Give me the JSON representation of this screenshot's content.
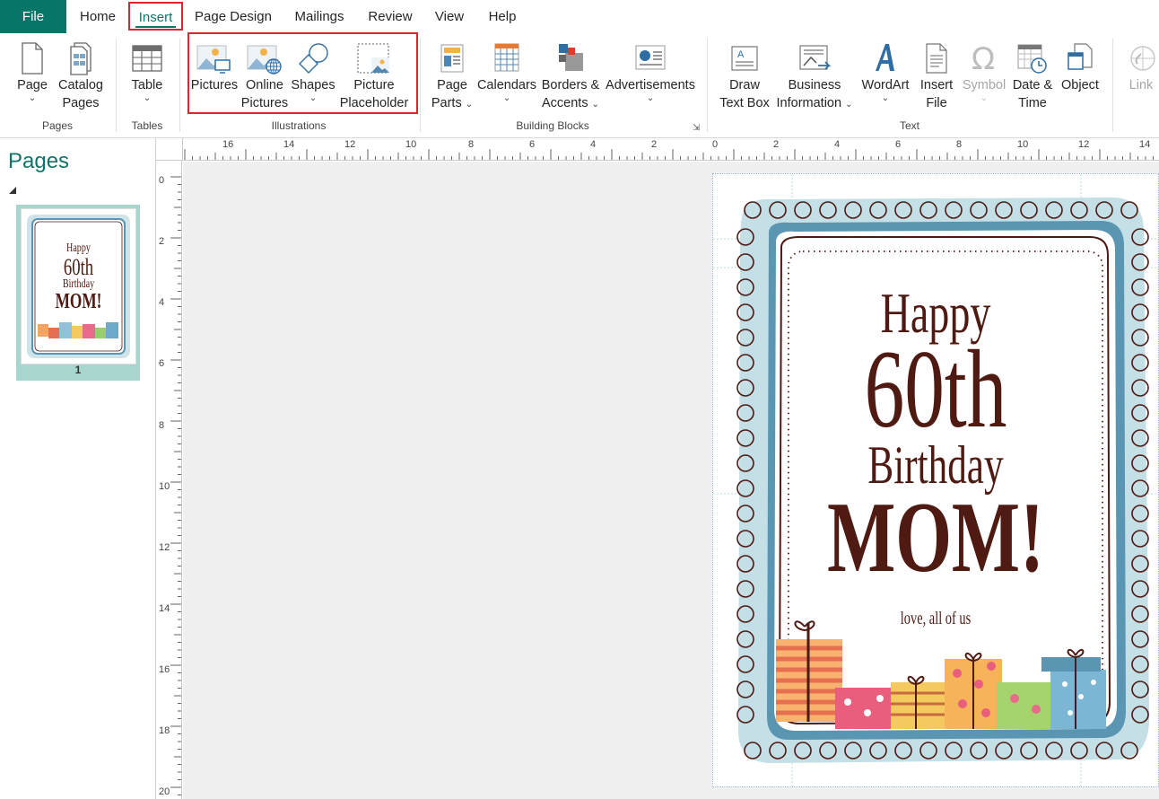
{
  "tabs": {
    "file": "File",
    "home": "Home",
    "insert": "Insert",
    "page_design": "Page Design",
    "mailings": "Mailings",
    "review": "Review",
    "view": "View",
    "help": "Help"
  },
  "ribbon": {
    "pages": {
      "page_label": "Page",
      "catalog_line1": "Catalog",
      "catalog_line2": "Pages",
      "group": "Pages"
    },
    "tables": {
      "table_label": "Table",
      "group": "Tables"
    },
    "illustrations": {
      "pictures": "Pictures",
      "online_line1": "Online",
      "online_line2": "Pictures",
      "shapes": "Shapes",
      "placeholder_line1": "Picture",
      "placeholder_line2": "Placeholder",
      "group": "Illustrations"
    },
    "building_blocks": {
      "page_parts_line1": "Page",
      "page_parts_line2": "Parts",
      "calendars": "Calendars",
      "borders_line1": "Borders &",
      "borders_line2": "Accents",
      "advertisements": "Advertisements",
      "group": "Building Blocks"
    },
    "text": {
      "draw_line1": "Draw",
      "draw_line2": "Text Box",
      "business_line1": "Business",
      "business_line2": "Information",
      "wordart": "WordArt",
      "insert_file_line1": "Insert",
      "insert_file_line2": "File",
      "symbol": "Symbol",
      "date_line1": "Date &",
      "date_line2": "Time",
      "object": "Object",
      "group": "Text"
    },
    "links": {
      "link": "Link"
    }
  },
  "rulers": {
    "horizontal": [
      "16",
      "14",
      "12",
      "10",
      "8",
      "6",
      "4",
      "2",
      "0",
      "2",
      "4",
      "6",
      "8",
      "10",
      "12",
      "14"
    ],
    "vertical": [
      "0",
      "2",
      "4",
      "6",
      "8",
      "10",
      "12",
      "14",
      "16",
      "18",
      "20"
    ]
  },
  "pages_panel": {
    "title": "Pages",
    "page_number": "1"
  },
  "card": {
    "line1": "Happy",
    "line2": "60th",
    "line3": "Birthday",
    "line4": "MOM!",
    "signature": "love, all of us"
  },
  "colors": {
    "file_tab": "#077568",
    "accent": "#0f7468",
    "highlight": "#e0242f",
    "card_text": "#4e1a12",
    "frame_outer": "#c5dfe6",
    "frame_blue": "#5a96b2"
  }
}
